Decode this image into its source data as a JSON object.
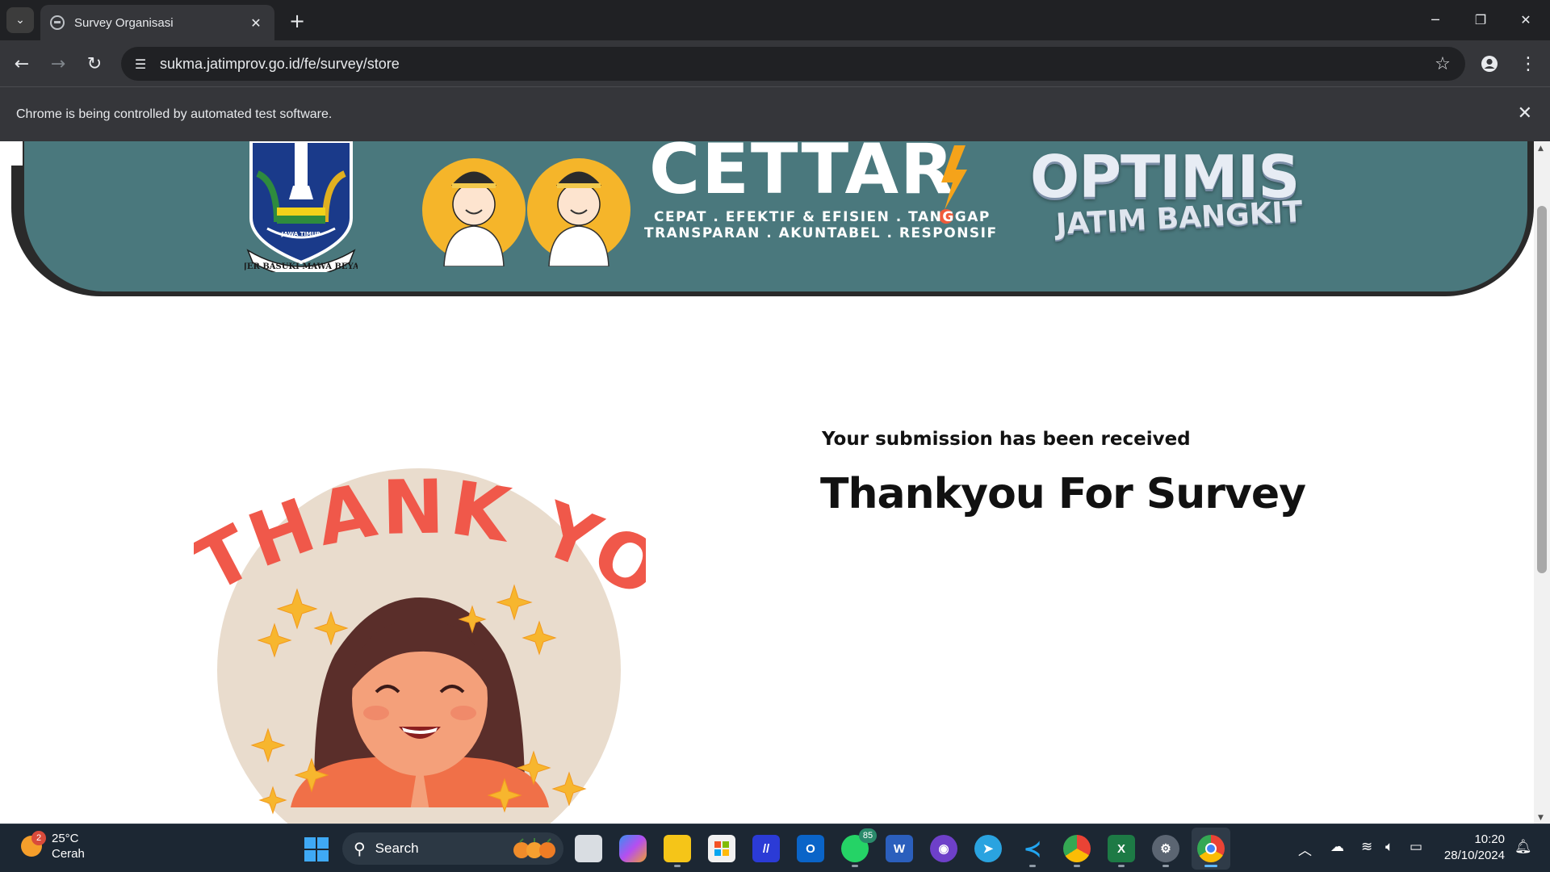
{
  "browser": {
    "tab_title": "Survey Organisasi",
    "url": "sukma.jatimprov.go.id/fe/survey/store",
    "infobar_text": "Chrome is being controlled by automated test software."
  },
  "banner": {
    "crest_text": "JER BASUKI MAWA BEYA",
    "crest_label": "JAWA TIMUR",
    "cettar_word": "CETTAR",
    "cettar_tagline_1": "CEPAT . EFEKTIF & EFISIEN . TANGGAP",
    "cettar_tagline_2": "TRANSPARAN . AKUNTABEL . RESPONSIF",
    "optimis_word": "OPTIMIS",
    "optimis_sub": "JATIM BANGKIT"
  },
  "main": {
    "illustration_heading": "THANK YOU",
    "submission_text": "Your submission has been received",
    "thank_title": "Thankyou For Survey"
  },
  "taskbar": {
    "weather_badge": "2",
    "weather_temp": "25°C",
    "weather_condition": "Cerah",
    "search_label": "Search",
    "whatsapp_badge": "85",
    "clock_time": "10:20",
    "clock_date": "28/10/2024",
    "apps": [
      "file-explorer-desktop",
      "copilot",
      "file-explorer",
      "microsoft-store",
      "vpn-app",
      "outlook",
      "whatsapp",
      "word",
      "github-desktop",
      "telegram",
      "vscode",
      "chrome-profile",
      "excel",
      "settings",
      "chrome"
    ]
  },
  "colors": {
    "banner_teal": "#4a787d",
    "thank_you_coral": "#f0584a",
    "tab_bg": "#35363a",
    "taskbar_bg": "#1c2733"
  }
}
